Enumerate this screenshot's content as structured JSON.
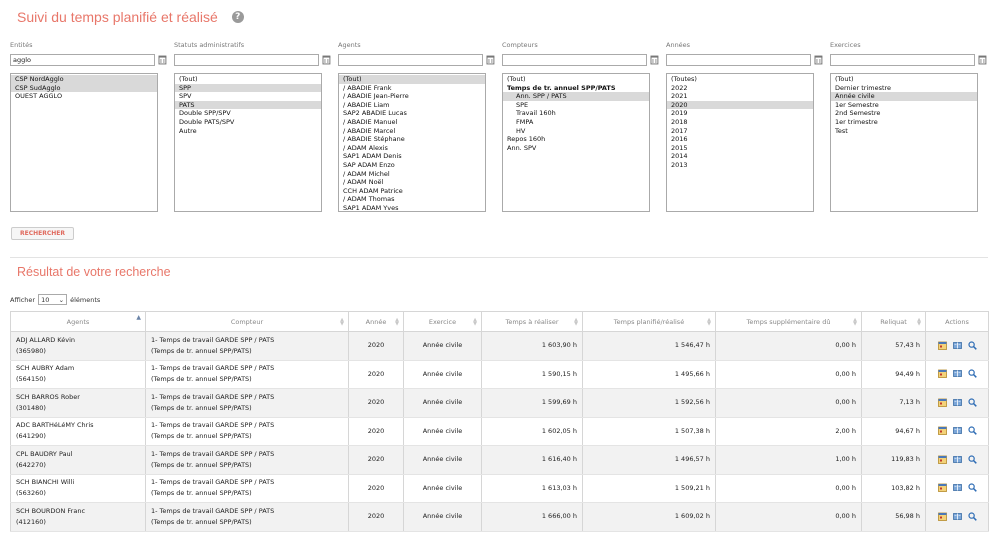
{
  "page": {
    "title": "Suivi du temps planifié et réalisé",
    "help_icon": "?"
  },
  "filters": [
    {
      "label": "Entités",
      "search_value": "agglo",
      "options": [
        {
          "text": "CSP NordAgglo",
          "selected": true
        },
        {
          "text": "CSP SudAgglo",
          "selected": true
        },
        {
          "text": "OUEST AGGLO",
          "selected": false
        }
      ]
    },
    {
      "label": "Statuts administratifs",
      "search_value": "",
      "options": [
        {
          "text": "(Tout)",
          "selected": false
        },
        {
          "text": "SPP",
          "selected": true
        },
        {
          "text": "SPV",
          "selected": false
        },
        {
          "text": "PATS",
          "selected": true
        },
        {
          "text": "Double SPP/SPV",
          "selected": false
        },
        {
          "text": "Double PATS/SPV",
          "selected": false
        },
        {
          "text": "Autre",
          "selected": false
        }
      ]
    },
    {
      "label": "Agents",
      "search_value": "",
      "options": [
        {
          "text": "(Tout)",
          "selected": true
        },
        {
          "text": "/ ABADIE Frank",
          "selected": false
        },
        {
          "text": "/ ABADIE Jean-Pierre",
          "selected": false
        },
        {
          "text": "/ ABADIE Liam",
          "selected": false
        },
        {
          "text": "SAP2 ABADIE Lucas",
          "selected": false
        },
        {
          "text": "/ ABADIE Manuel",
          "selected": false
        },
        {
          "text": "/ ABADIE Marcel",
          "selected": false
        },
        {
          "text": "/ ABADIE Stéphane",
          "selected": false
        },
        {
          "text": "/ ADAM Alexis",
          "selected": false
        },
        {
          "text": "SAP1 ADAM Denis",
          "selected": false
        },
        {
          "text": "SAP ADAM Enzo",
          "selected": false
        },
        {
          "text": "/ ADAM Michel",
          "selected": false
        },
        {
          "text": "/ ADAM Noël",
          "selected": false
        },
        {
          "text": "CCH ADAM Patrice",
          "selected": false
        },
        {
          "text": "/ ADAM Thomas",
          "selected": false
        },
        {
          "text": "SAP1 ADAM Yves",
          "selected": false
        }
      ]
    },
    {
      "label": "Compteurs",
      "search_value": "",
      "options": [
        {
          "text": "(Tout)",
          "selected": false
        },
        {
          "text": "Temps de tr. annuel SPP/PATS",
          "selected": false,
          "bold": true
        },
        {
          "text": "Ann. SPP / PATS",
          "selected": true,
          "indent": true
        },
        {
          "text": "SPE",
          "selected": false,
          "indent": true
        },
        {
          "text": "Travail 160h",
          "selected": false,
          "indent": true
        },
        {
          "text": "FMPA",
          "selected": false,
          "indent": true
        },
        {
          "text": "HV",
          "selected": false,
          "indent": true
        },
        {
          "text": "Repos 160h",
          "selected": false
        },
        {
          "text": "Ann. SPV",
          "selected": false
        }
      ]
    },
    {
      "label": "Années",
      "search_value": "",
      "options": [
        {
          "text": "(Toutes)",
          "selected": false
        },
        {
          "text": "2022",
          "selected": false
        },
        {
          "text": "2021",
          "selected": false
        },
        {
          "text": "2020",
          "selected": true
        },
        {
          "text": "2019",
          "selected": false
        },
        {
          "text": "2018",
          "selected": false
        },
        {
          "text": "2017",
          "selected": false
        },
        {
          "text": "2016",
          "selected": false
        },
        {
          "text": "2015",
          "selected": false
        },
        {
          "text": "2014",
          "selected": false
        },
        {
          "text": "2013",
          "selected": false
        }
      ]
    },
    {
      "label": "Exercices",
      "search_value": "",
      "options": [
        {
          "text": "(Tout)",
          "selected": false
        },
        {
          "text": "Dernier trimestre",
          "selected": false
        },
        {
          "text": "Année civile",
          "selected": true
        },
        {
          "text": "1er Semestre",
          "selected": false
        },
        {
          "text": "2nd Semestre",
          "selected": false
        },
        {
          "text": "1er trimestre",
          "selected": false
        },
        {
          "text": "Test",
          "selected": false
        }
      ]
    }
  ],
  "search_button": "RECHERCHER",
  "results": {
    "title": "Résultat de votre recherche",
    "length_prefix": "Afficher",
    "length_value": "10",
    "length_suffix": "éléments",
    "columns": [
      "Agents",
      "Compteur",
      "Année",
      "Exercice",
      "Temps à réaliser",
      "Temps planifié/réalisé",
      "Temps supplémentaire dû",
      "Reliquat",
      "Actions"
    ],
    "rows": [
      {
        "agent": "ADJ ALLARD Kévin",
        "agent_id": "(365980)",
        "compteur": "1- Temps de travail GARDE SPP / PATS",
        "compteur_sub": "(Temps de tr. annuel SPP/PATS)",
        "annee": "2020",
        "exercice": "Année civile",
        "a_realiser": "1 603,90 h",
        "planifie": "1 546,47 h",
        "supp": "0,00 h",
        "reliquat": "57,43 h"
      },
      {
        "agent": "SCH AUBRY Adam",
        "agent_id": "(564150)",
        "compteur": "1- Temps de travail GARDE SPP / PATS",
        "compteur_sub": "(Temps de tr. annuel SPP/PATS)",
        "annee": "2020",
        "exercice": "Année civile",
        "a_realiser": "1 590,15 h",
        "planifie": "1 495,66 h",
        "supp": "0,00 h",
        "reliquat": "94,49 h"
      },
      {
        "agent": "SCH BARROS Rober",
        "agent_id": "(301480)",
        "compteur": "1- Temps de travail GARDE SPP / PATS",
        "compteur_sub": "(Temps de tr. annuel SPP/PATS)",
        "annee": "2020",
        "exercice": "Année civile",
        "a_realiser": "1 599,69 h",
        "planifie": "1 592,56 h",
        "supp": "0,00 h",
        "reliquat": "7,13 h"
      },
      {
        "agent": "ADC BARTHéLéMY Chris",
        "agent_id": "(641290)",
        "compteur": "1- Temps de travail GARDE SPP / PATS",
        "compteur_sub": "(Temps de tr. annuel SPP/PATS)",
        "annee": "2020",
        "exercice": "Année civile",
        "a_realiser": "1 602,05 h",
        "planifie": "1 507,38 h",
        "supp": "2,00 h",
        "reliquat": "94,67 h"
      },
      {
        "agent": "CPL BAUDRY Paul",
        "agent_id": "(642270)",
        "compteur": "1- Temps de travail GARDE SPP / PATS",
        "compteur_sub": "(Temps de tr. annuel SPP/PATS)",
        "annee": "2020",
        "exercice": "Année civile",
        "a_realiser": "1 616,40 h",
        "planifie": "1 496,57 h",
        "supp": "1,00 h",
        "reliquat": "119,83 h"
      },
      {
        "agent": "SCH BIANCHI Willi",
        "agent_id": "(563260)",
        "compteur": "1- Temps de travail GARDE SPP / PATS",
        "compteur_sub": "(Temps de tr. annuel SPP/PATS)",
        "annee": "2020",
        "exercice": "Année civile",
        "a_realiser": "1 613,03 h",
        "planifie": "1 509,21 h",
        "supp": "0,00 h",
        "reliquat": "103,82 h"
      },
      {
        "agent": "SCH BOURDON Franc",
        "agent_id": "(412160)",
        "compteur": "1- Temps de travail GARDE SPP / PATS",
        "compteur_sub": "(Temps de tr. annuel SPP/PATS)",
        "annee": "2020",
        "exercice": "Année civile",
        "a_realiser": "1 666,00 h",
        "planifie": "1 609,02 h",
        "supp": "0,00 h",
        "reliquat": "56,98 h"
      }
    ]
  },
  "icons": {
    "help": "help-icon",
    "clear": "eraser-icon",
    "actions": [
      "calendar-icon",
      "book-icon",
      "search-icon"
    ]
  },
  "colors": {
    "accent": "#e8776a",
    "row_alt": "#f2f2f2",
    "selected_option": "#d9d9d9",
    "border": "#d6d6d6"
  }
}
